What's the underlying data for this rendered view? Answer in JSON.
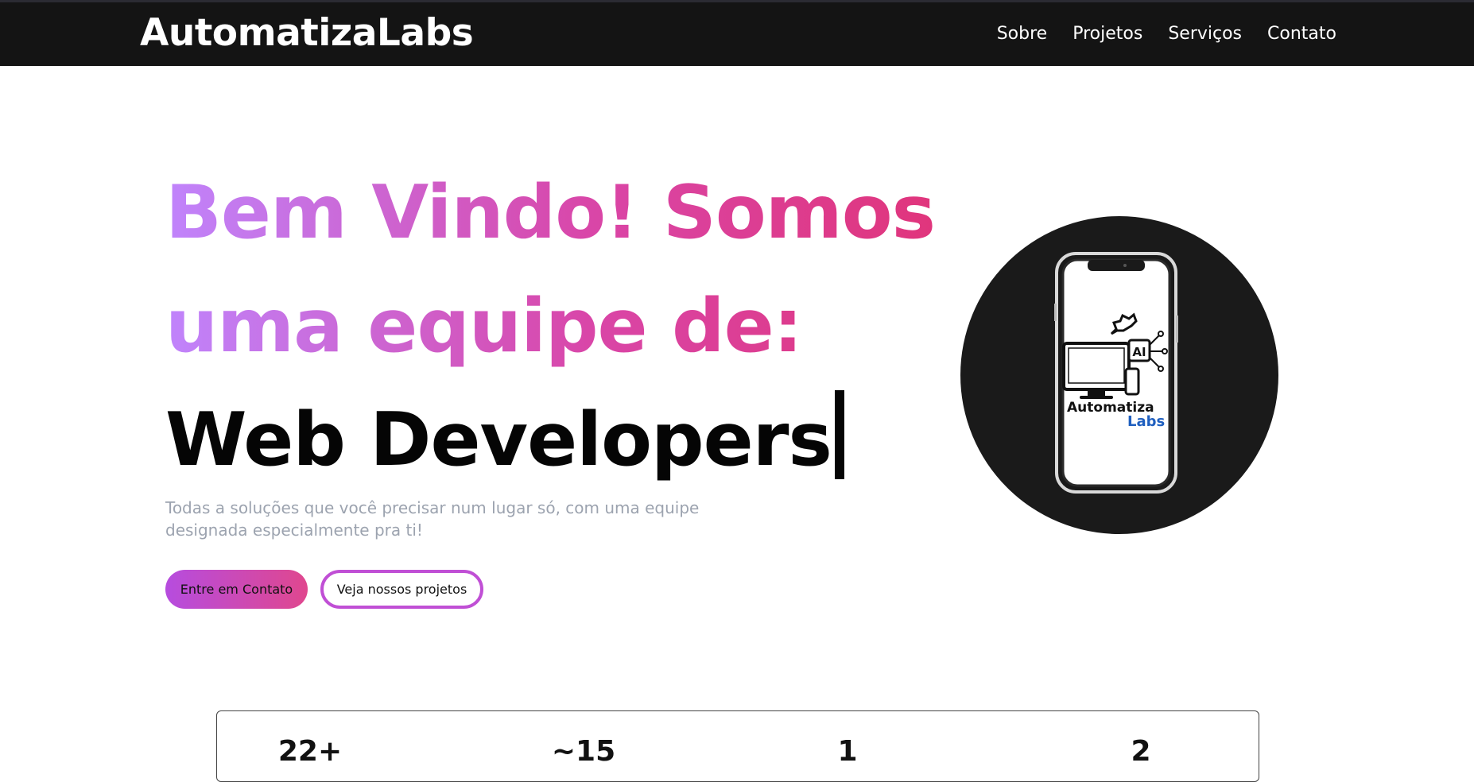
{
  "nav": {
    "brand": "AutomatizaLabs",
    "links": [
      "Sobre",
      "Projetos",
      "Serviços",
      "Contato"
    ]
  },
  "hero": {
    "title_line1": "Bem Vindo! Somos",
    "title_line2": "uma equipe de:",
    "typed_text": "Web Developers",
    "subtitle": "Todas a soluções que você precisar num lugar só, com uma equipe designada especialmente pra ti!",
    "primary_button": "Entre em Contato",
    "secondary_button": "Veja nossos projetos"
  },
  "logo": {
    "line1": "Automatiza",
    "line2": "Labs",
    "chip": "AI",
    "icon": "phone-computer-ai-logo"
  },
  "stats": {
    "values": [
      "22+",
      "~15",
      "1",
      "2"
    ]
  },
  "colors": {
    "navbar_bg": "#141414",
    "gradient_start": "#c084fc",
    "gradient_end": "#e0357c",
    "subtitle": "#9ca3af",
    "logo_blue": "#1f5fbf"
  }
}
